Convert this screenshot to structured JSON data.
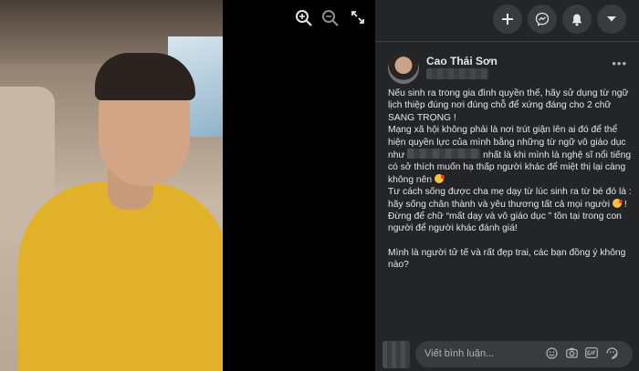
{
  "viewer": {
    "icons": [
      "zoom-in-icon",
      "zoom-out-icon",
      "fullscreen-icon"
    ]
  },
  "topbar": {
    "icons": [
      "plus-icon",
      "messenger-icon",
      "notifications-icon",
      "chevron-down-icon"
    ]
  },
  "post": {
    "author": "Cao Thái Sơn",
    "more_label": "•••",
    "paragraphs": [
      "Nếu sinh ra trong gia đình quyền thế, hãy sử dụng từ ngữ lịch thiệp đúng nơi đúng chỗ để xứng đáng cho 2 chữ SANG TRỌNG !",
      "Mạng xã hội không phải là nơi trút giận lên ai đó để thể hiện quyền lực của mình bằng những từ ngữ vô giáo dục như",
      "nhất là khi mình là nghệ sĩ nổi tiếng có sở thích muốn hạ thấp người khác để miệt thị lại càng không nên",
      "Tư cách sống được cha mẹ dạy từ lúc sinh ra từ bé đó là : hãy sống chân thành và yêu thương tất cả mọi người",
      "! Đừng để chữ “mất dạy và vô giáo dục ” tồn tại trong con người để người khác đánh giá!",
      "Mình là người tử tế và rất đẹp trai, các bạn đồng ý không nào?"
    ]
  },
  "comment": {
    "placeholder": "Viết bình luận...",
    "icons": [
      "emoji-icon",
      "camera-icon",
      "gif-icon",
      "sticker-icon"
    ]
  },
  "colors": {
    "panel_bg": "#242526",
    "button_bg": "#3a3b3c",
    "text": "#e4e6eb",
    "muted": "#b0b3b8"
  }
}
